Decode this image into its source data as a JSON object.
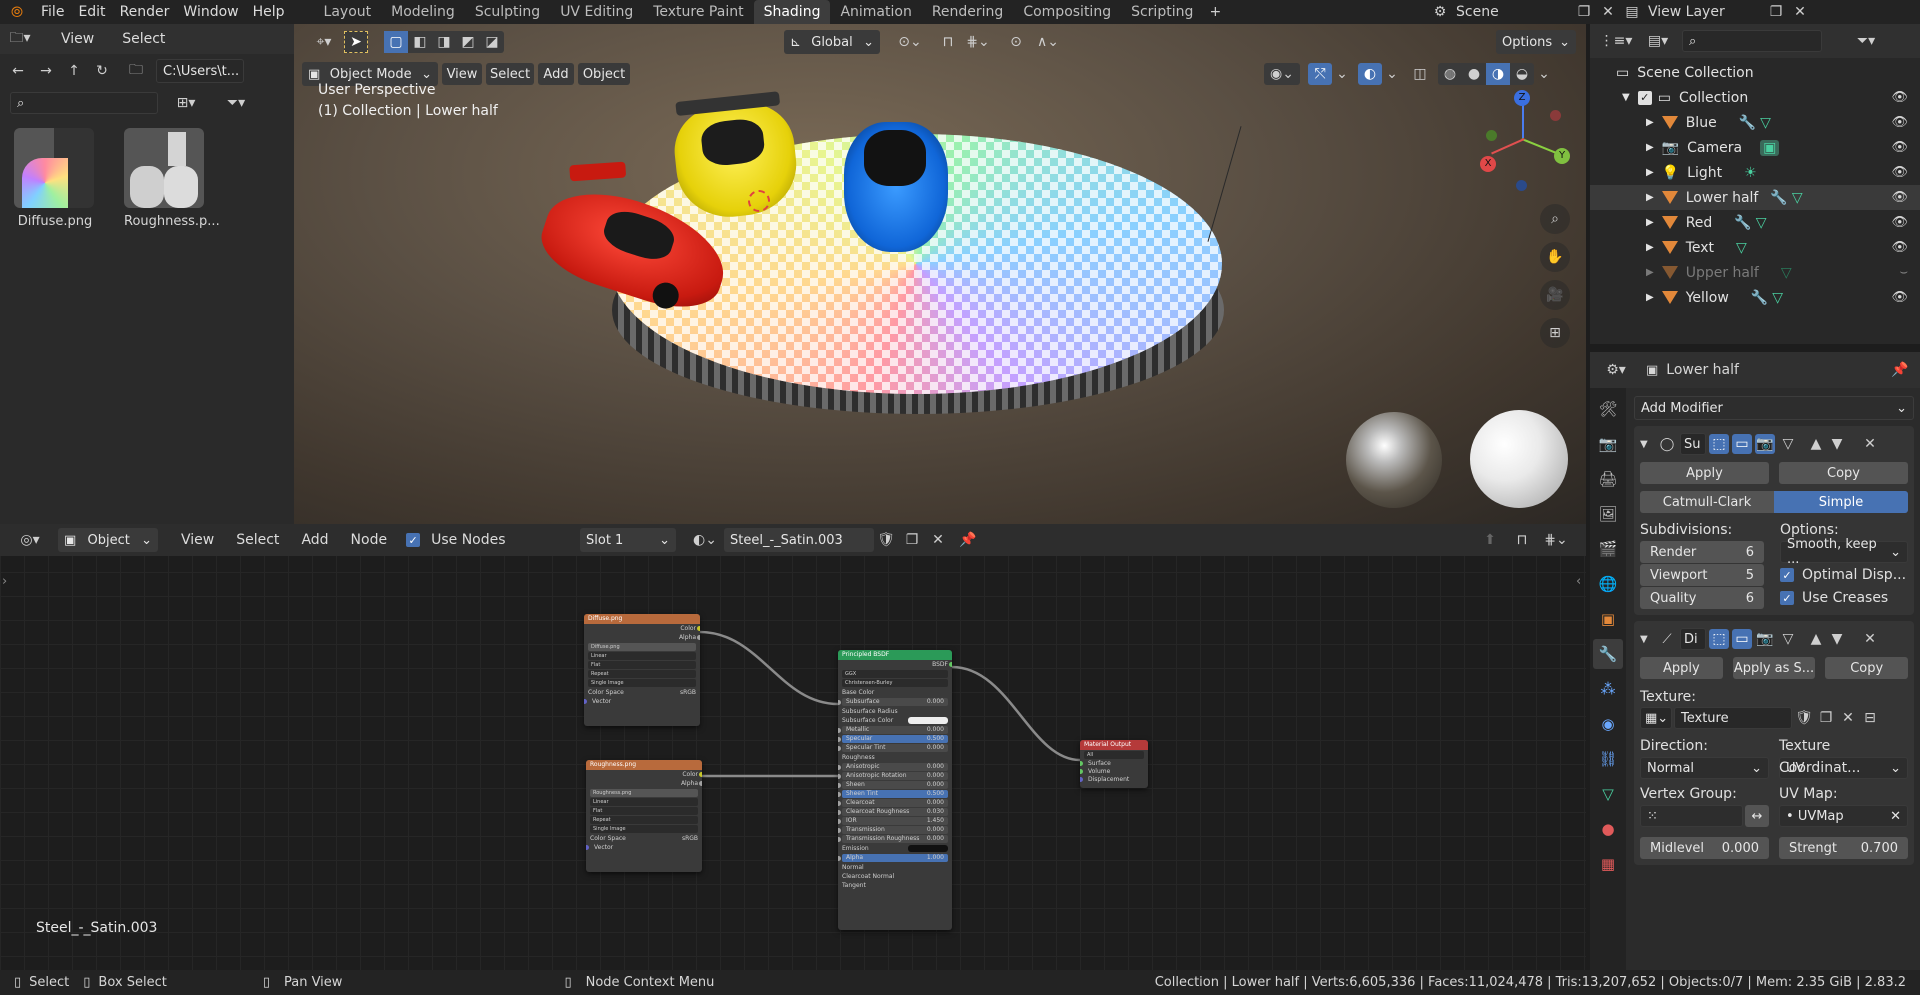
{
  "topbar": {
    "menus": [
      "File",
      "Edit",
      "Render",
      "Window",
      "Help"
    ],
    "workspaces": [
      "Layout",
      "Modeling",
      "Sculpting",
      "UV Editing",
      "Texture Paint",
      "Shading",
      "Animation",
      "Rendering",
      "Compositing",
      "Scripting"
    ],
    "active_workspace": "Shading",
    "scene": "Scene",
    "view_layer": "View Layer"
  },
  "file_browser": {
    "view": "View",
    "select": "Select",
    "path": "C:\\Users\\t...",
    "files": [
      "Diffuse.png",
      "Roughness.p..."
    ]
  },
  "viewport": {
    "transform_orientation": "Global",
    "options": "Options",
    "mode": "Object Mode",
    "menus": [
      "View",
      "Select",
      "Add",
      "Object"
    ],
    "perspective": "User Perspective",
    "collection_info": "(1) Collection | Lower half",
    "gizmo": {
      "x": "X",
      "y": "Y",
      "z": "Z"
    }
  },
  "outliner": {
    "scene_collection": "Scene Collection",
    "collection": "Collection",
    "items": [
      "Blue",
      "Camera",
      "Light",
      "Lower half",
      "Red",
      "Text",
      "Upper half",
      "Yellow"
    ]
  },
  "properties": {
    "object_name": "Lower half",
    "add_modifier": "Add Modifier",
    "subsurf": {
      "name": "Su",
      "apply": "Apply",
      "copy": "Copy",
      "catmull": "Catmull-Clark",
      "simple": "Simple",
      "subdivisions": "Subdivisions:",
      "options": "Options:",
      "render_label": "Render",
      "render_val": "6",
      "viewport_label": "Viewport",
      "viewport_val": "5",
      "quality_label": "Quality",
      "quality_val": "6",
      "uv_smooth": "Smooth, keep ...",
      "optimal": "Optimal Disp...",
      "creases": "Use Creases"
    },
    "displace": {
      "name": "Di",
      "apply": "Apply",
      "apply_as": "Apply as S...",
      "copy": "Copy",
      "texture_label": "Texture:",
      "texture": "Texture",
      "direction_label": "Direction:",
      "direction": "Normal",
      "coords_label": "Texture Coordinat...",
      "coords": "UV",
      "vgroup_label": "Vertex Group:",
      "uvmap_label": "UV Map:",
      "uvmap": "UVMap",
      "midlevel": "Midlevel",
      "midlevel_val": "0.000",
      "strength": "Strengt",
      "strength_val": "0.700"
    }
  },
  "node_editor": {
    "object": "Object",
    "menus": [
      "View",
      "Select",
      "Add",
      "Node"
    ],
    "use_nodes": "Use Nodes",
    "slot": "Slot 1",
    "material": "Steel_-_Satin.003",
    "material_label": "Steel_-_Satin.003",
    "nodes": {
      "diffuse": {
        "title": "Diffuse.png",
        "img": "Diffuse.png",
        "out": [
          "Color",
          "Alpha"
        ],
        "rows": [
          "Linear",
          "Flat",
          "Repeat",
          "Single Image"
        ],
        "cs": "Color Space",
        "csv": "sRGB",
        "vec": "Vector"
      },
      "rough": {
        "title": "Roughness.png",
        "img": "Roughness.png",
        "out": [
          "Color",
          "Alpha"
        ],
        "rows": [
          "Linear",
          "Flat",
          "Repeat",
          "Single Image"
        ],
        "cs": "Color Space",
        "csv": "sRGB",
        "vec": "Vector"
      },
      "bsdf": {
        "title": "Principled BSDF",
        "out": "BSDF",
        "rows": [
          "GGX",
          "Christensen-Burley",
          "Base Color",
          "Subsurface",
          "Subsurface Radius",
          "Subsurface Color",
          "Metallic",
          "Specular",
          "Specular Tint",
          "Roughness",
          "Anisotropic",
          "Anisotropic Rotation",
          "Sheen",
          "Sheen Tint",
          "Clearcoat",
          "Clearcoat Roughness",
          "IOR",
          "Transmission",
          "Transmission Roughness",
          "Emission",
          "Alpha",
          "Normal",
          "Clearcoat Normal",
          "Tangent"
        ],
        "vals": [
          "",
          "",
          "",
          "0.000",
          "",
          "",
          "0.000",
          "0.500",
          "0.000",
          "",
          "0.000",
          "0.000",
          "0.000",
          "0.500",
          "0.000",
          "0.030",
          "1.450",
          "0.000",
          "0.000",
          "",
          "1.000",
          "",
          "",
          ""
        ]
      },
      "output": {
        "title": "Material Output",
        "rows": [
          "All",
          "Surface",
          "Volume",
          "Displacement"
        ]
      }
    }
  },
  "statusbar": {
    "select": "Select",
    "box_select": "Box Select",
    "pan": "Pan View",
    "context": "Node Context Menu",
    "stats": "Collection | Lower half | Verts:6,605,336 | Faces:11,024,478 | Tris:13,207,652 | Objects:0/7 | Mem: 2.35 GiB | 2.83.2"
  },
  "colors": {
    "accent": "#4772b3",
    "tri": "#e2883a",
    "texnode": "#b86a3c",
    "bsdf": "#2b9a58",
    "out": "#b53a3a"
  }
}
